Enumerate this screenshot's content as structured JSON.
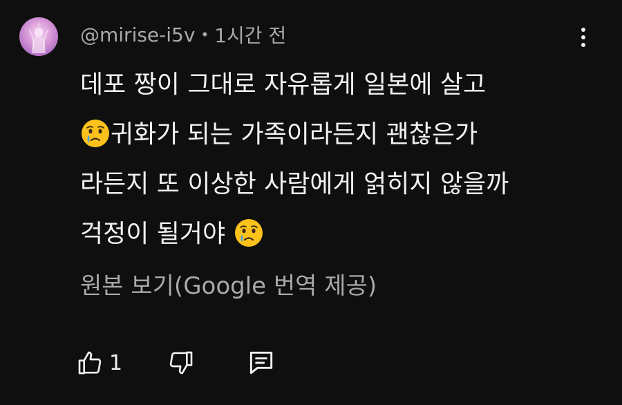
{
  "comment": {
    "author": "@mirise-i5v",
    "separator": "•",
    "time": "1시간 전",
    "lines": [
      "데포 짱이 그대로 자유롭게 일본에 살고",
      "귀화가 되는 가족이라든지 괜찮은가",
      "라든지 또 이상한 사람에게 얽히지 않을까",
      "걱정이 될거야 "
    ],
    "emoji": "crying-face",
    "translate_label": "원본 보기(Google 번역 제공)",
    "like_count": "1"
  },
  "icons": {
    "avatar": "avatar-image",
    "menu": "more-vert-icon",
    "like": "thumb-up-icon",
    "dislike": "thumb-down-icon",
    "reply": "reply-comment-icon"
  },
  "colors": {
    "background": "#0f0f0f",
    "primary_text": "#f1f1f1",
    "secondary_text": "#aaaaaa"
  }
}
